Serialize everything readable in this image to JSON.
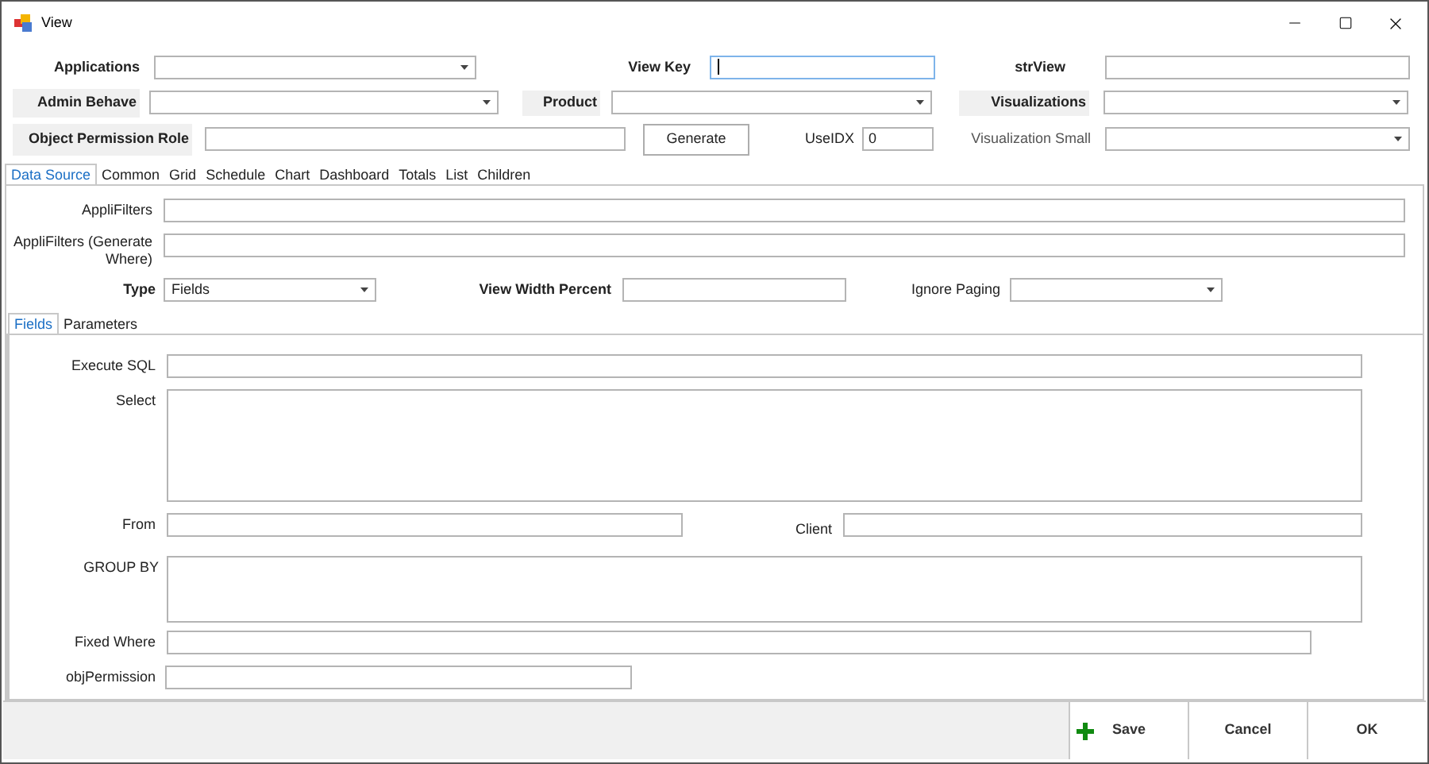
{
  "window": {
    "title": "View"
  },
  "header": {
    "applications": {
      "label": "Applications"
    },
    "view_key": {
      "label": "View Key",
      "focused": true
    },
    "str_view": {
      "label": "strView"
    },
    "admin_behave": {
      "label": "Admin Behave"
    },
    "product": {
      "label": "Product"
    },
    "visualizations": {
      "label": "Visualizations"
    },
    "object_permission_role": {
      "label": "Object Permission Role"
    },
    "generate_button": "Generate",
    "use_idx": {
      "label": "UseIDX",
      "value": "0"
    },
    "visualization_small": {
      "label": "Visualization Small"
    }
  },
  "tabs": [
    {
      "label": "Data Source",
      "selected": true
    },
    {
      "label": "Common",
      "selected": false
    },
    {
      "label": "Grid",
      "selected": false
    },
    {
      "label": "Schedule",
      "selected": false
    },
    {
      "label": "Chart",
      "selected": false
    },
    {
      "label": "Dashboard",
      "selected": false
    },
    {
      "label": "Totals",
      "selected": false
    },
    {
      "label": "List",
      "selected": false
    },
    {
      "label": "Children",
      "selected": false
    }
  ],
  "data_source": {
    "appli_filters": "AppliFilters",
    "appli_filters_where": "AppliFilters (Generate Where)",
    "type": {
      "label": "Type",
      "value": "Fields"
    },
    "view_width_percent": "View Width Percent",
    "ignore_paging": "Ignore Paging"
  },
  "sub_tabs": [
    {
      "label": "Fields",
      "selected": true
    },
    {
      "label": "Parameters",
      "selected": false
    }
  ],
  "fields": {
    "execute_sql": "Execute SQL",
    "select": "Select",
    "from": "From",
    "client": "Client",
    "group_by": "GROUP BY",
    "fixed_where": "Fixed Where",
    "obj_permission": "objPermission"
  },
  "footer": {
    "buttons": [
      {
        "label": "Save",
        "kind": "save"
      },
      {
        "label": "Cancel",
        "kind": "plain"
      },
      {
        "label": "OK",
        "kind": "plain"
      }
    ]
  }
}
